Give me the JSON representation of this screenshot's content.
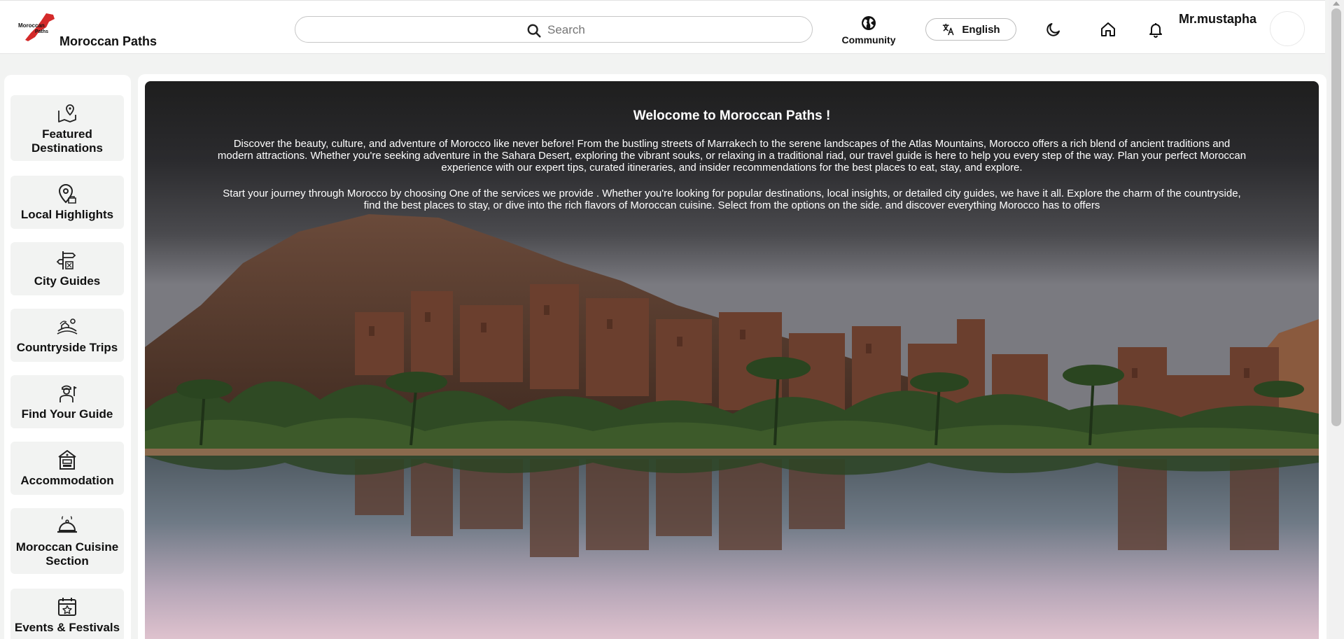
{
  "header": {
    "brand": "Moroccan Paths",
    "search_placeholder": "Search",
    "community_label": "Community",
    "language_label": "English",
    "username": "Mr.mustapha"
  },
  "icons": {
    "logo": "morocco-map-logo-icon",
    "search": "search-icon",
    "community": "globe-icon",
    "language": "translate-icon",
    "dark_mode": "moon-icon",
    "home": "home-icon",
    "notifications": "bell-icon"
  },
  "sidebar": {
    "items": [
      {
        "label": "Featured Destinations",
        "icon": "map-pin-icon"
      },
      {
        "label": "Local Highlights",
        "icon": "location-search-icon"
      },
      {
        "label": "City Guides",
        "icon": "signpost-icon"
      },
      {
        "label": "Countryside Trips",
        "icon": "countryside-icon"
      },
      {
        "label": "Find Your Guide",
        "icon": "tour-guide-icon"
      },
      {
        "label": "Accommodation",
        "icon": "hotel-icon"
      },
      {
        "label": "Moroccan Cuisine Section",
        "icon": "cloche-icon"
      },
      {
        "label": "Events & Festivals",
        "icon": "calendar-star-icon"
      }
    ]
  },
  "hero": {
    "title": "Welocome to Moroccan Paths !",
    "paragraph1": "Discover the beauty, culture, and adventure of Morocco like never before! From the bustling streets of Marrakech to the serene landscapes of the Atlas Mountains, Morocco offers a rich blend of ancient traditions and modern attractions. Whether you're seeking adventure in the Sahara Desert, exploring the vibrant souks, or relaxing in a traditional riad, our travel guide is here to help you every step of the way. Plan your perfect Moroccan experience with our expert tips, curated itineraries, and insider recommendations for the best places to eat, stay, and explore.",
    "paragraph2": "Start your journey through Morocco by choosing One of the services we provide . Whether you're looking for popular destinations, local insights, or detailed city guides, we have it all. Explore the charm of the countryside, find the best places to stay, or dive into the rich flavors of Moroccan cuisine. Select from the options on the side. and discover everything Morocco has to offers"
  },
  "colors": {
    "page_bg": "#f2f3f2",
    "card_bg": "#ffffff",
    "sidebar_item_bg": "#f2f3f2",
    "logo_red": "#d42a2a"
  }
}
